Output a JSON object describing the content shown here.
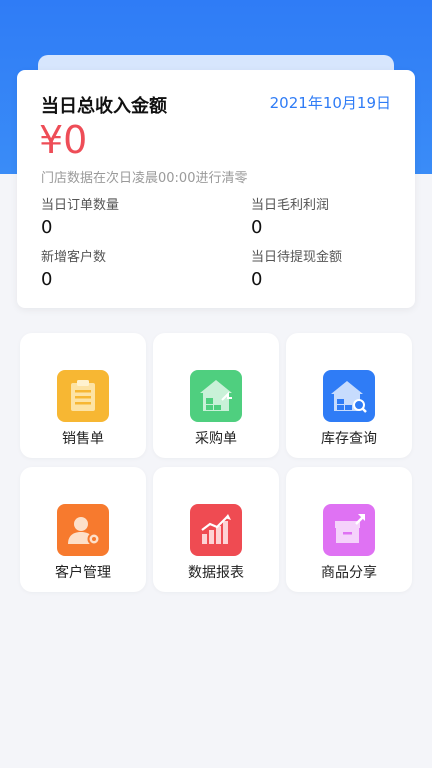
{
  "summary": {
    "title": "当日总收入金额",
    "date": "2021年10月19日",
    "amount": "¥0",
    "note": "门店数据在次日凌晨00:00进行清零",
    "stats": [
      {
        "label": "当日订单数量",
        "value": "0"
      },
      {
        "label": "当日毛利利润",
        "value": "0"
      },
      {
        "label": "新增客户数",
        "value": "0"
      },
      {
        "label": "当日待提现金额",
        "value": "0"
      }
    ]
  },
  "colors": {
    "accent": "#2f7cf6",
    "amount": "#ee4d57"
  },
  "tiles": [
    {
      "label": "销售单",
      "icon": "clipboard-icon",
      "color": "#f7b733"
    },
    {
      "label": "采购单",
      "icon": "house-boxes-icon",
      "color": "#4fcf7f"
    },
    {
      "label": "库存查询",
      "icon": "warehouse-search-icon",
      "color": "#2f7cf6"
    },
    {
      "label": "客户管理",
      "icon": "customer-gear-icon",
      "color": "#f77a2e"
    },
    {
      "label": "数据报表",
      "icon": "bar-chart-icon",
      "color": "#ef4b52"
    },
    {
      "label": "商品分享",
      "icon": "box-share-icon",
      "color": "#df72f3"
    }
  ]
}
